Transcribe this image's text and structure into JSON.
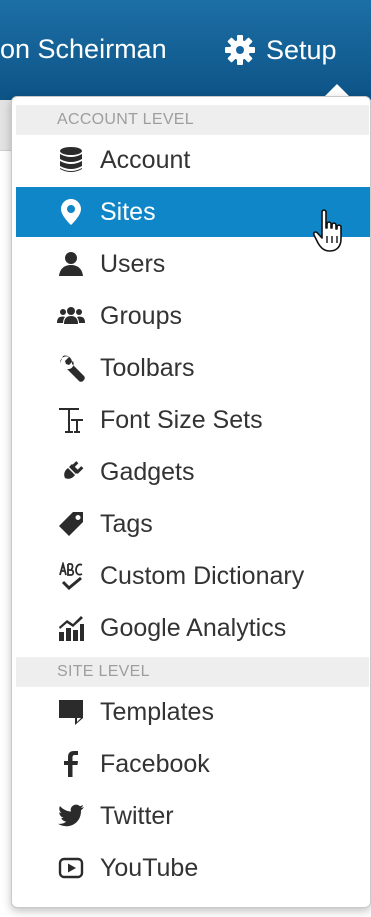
{
  "header": {
    "user_name": "on Scheirman",
    "setup_label": "Setup"
  },
  "menu": {
    "account_section": "ACCOUNT LEVEL",
    "site_section": "SITE LEVEL",
    "account_items": [
      {
        "label": "Account",
        "icon": "database-icon"
      },
      {
        "label": "Sites",
        "icon": "map-marker-icon",
        "active": true
      },
      {
        "label": "Users",
        "icon": "user-icon"
      },
      {
        "label": "Groups",
        "icon": "users-icon"
      },
      {
        "label": "Toolbars",
        "icon": "wrench-icon"
      },
      {
        "label": "Font Size Sets",
        "icon": "text-height-icon"
      },
      {
        "label": "Gadgets",
        "icon": "plug-icon"
      },
      {
        "label": "Tags",
        "icon": "tag-icon"
      },
      {
        "label": "Custom Dictionary",
        "icon": "spellcheck-icon"
      },
      {
        "label": "Google Analytics",
        "icon": "analytics-icon"
      }
    ],
    "site_items": [
      {
        "label": "Templates",
        "icon": "templates-icon"
      },
      {
        "label": "Facebook",
        "icon": "facebook-icon"
      },
      {
        "label": "Twitter",
        "icon": "twitter-icon"
      },
      {
        "label": "YouTube",
        "icon": "youtube-icon"
      }
    ]
  },
  "colors": {
    "topbar": "#0d5386",
    "active": "#0e86c8",
    "text": "#333333"
  }
}
